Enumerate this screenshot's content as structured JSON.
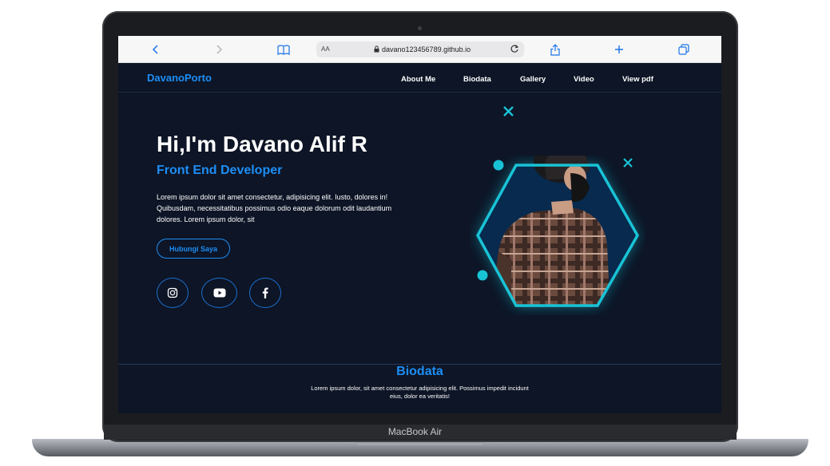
{
  "device": {
    "model_label": "MacBook Air"
  },
  "browser": {
    "url": "davano123456789.github.io",
    "text_size_label": "AA",
    "icons": [
      "back-icon",
      "forward-icon",
      "bookmarks-icon",
      "lock-icon",
      "reload-icon",
      "share-icon",
      "new-tab-icon",
      "tabs-icon"
    ]
  },
  "site": {
    "brand": "DavanoPorto",
    "nav": [
      "About Me",
      "Biodata",
      "Gallery",
      "Video",
      "View pdf"
    ],
    "hero": {
      "title": "Hi,I'm Davano Alif R",
      "subtitle": "Front End Developer",
      "description": "Lorem ipsum dolor sit amet consectetur, adipisicing elit. Iusto, dolores in! Quibusdam, necessitatibus possimus odio eaque dolorum odit laudantium dolores. Lorem ipsum dolor, sit",
      "cta_label": "Hubungi Saya",
      "social_icons": [
        "instagram-icon",
        "youtube-icon",
        "facebook-icon"
      ]
    },
    "biodata": {
      "title": "Biodata",
      "text": "Lorem ipsum dolor, sit amet consectetur adipisicing elit. Possimus impedit incidunt eius, dolor ea veritatis!"
    }
  },
  "colors": {
    "background": "#0d1526",
    "accent_blue": "#1d8ef5",
    "accent_cyan": "#19c3d6"
  }
}
